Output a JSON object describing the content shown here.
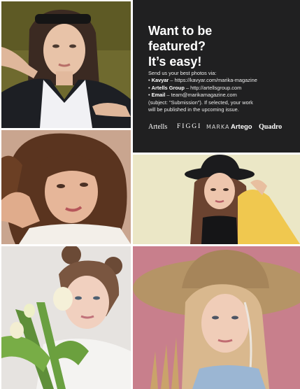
{
  "info": {
    "headline": [
      "Want to be",
      "featured?",
      "It’s easy!"
    ],
    "intro": "Send us your best photos via:",
    "items": [
      {
        "name": "Kavyar",
        "detail": " – https://kavyar.com/marika-magazine"
      },
      {
        "name": "Artells Group",
        "detail": " – http://artellsgroup.com"
      },
      {
        "name": "Email",
        "detail": " – team@marikamagazine.com"
      }
    ],
    "note": [
      "(subject: \"Submission\"). If selected, your work",
      "will be published in the upcoming issue."
    ],
    "logos": [
      "Artells",
      "FIGGI",
      "MARKA",
      "Artego",
      "Quadro"
    ]
  },
  "colors": {
    "info_background": "#202021",
    "page_background": "#ffffff"
  }
}
